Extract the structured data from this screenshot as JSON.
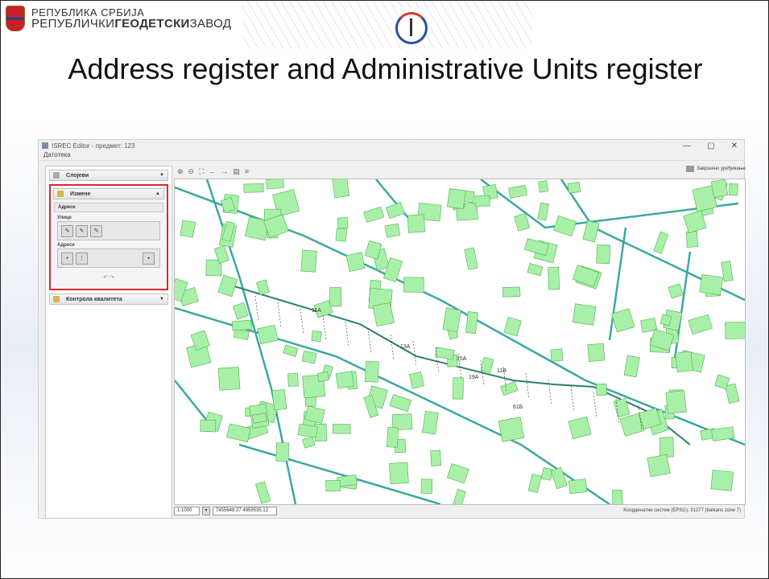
{
  "slide": {
    "org_line1": "РЕПУБЛИКА СРБИЈА",
    "org_line2_a": "РЕПУБЛИЧКИ",
    "org_line2_b": "ГЕОДЕТСКИ",
    "org_line2_c": "ЗАВОД",
    "title": "Address register and Administrative Units register"
  },
  "app": {
    "window_title": "ISREC Editor - предмет: 123",
    "menu": "Датотека",
    "window_controls": [
      "—",
      "▢",
      "✕"
    ],
    "panels": {
      "first": "Слојеви",
      "edit": "Измене",
      "addresses": "Адресе",
      "streets_label": "Улице",
      "addresses_label": "Адресе",
      "third": "Контрола квалитета"
    },
    "toolbar": {
      "save_label": "Завршено уређивање"
    },
    "status": {
      "scale": "1:1000",
      "coords": "7455648.37 4959535.12",
      "crs": "Координатни систем (EPSG): 31277 (balkans zone 7)"
    },
    "map_labels": [
      "11A",
      "13A",
      "15A",
      "19A",
      "11В",
      "61Б"
    ],
    "colors": {
      "parcel_fill": "#a8f0a8",
      "parcel_stroke": "#4fae4f",
      "street": "#3aa99c",
      "highlight": "#e0262a"
    }
  }
}
